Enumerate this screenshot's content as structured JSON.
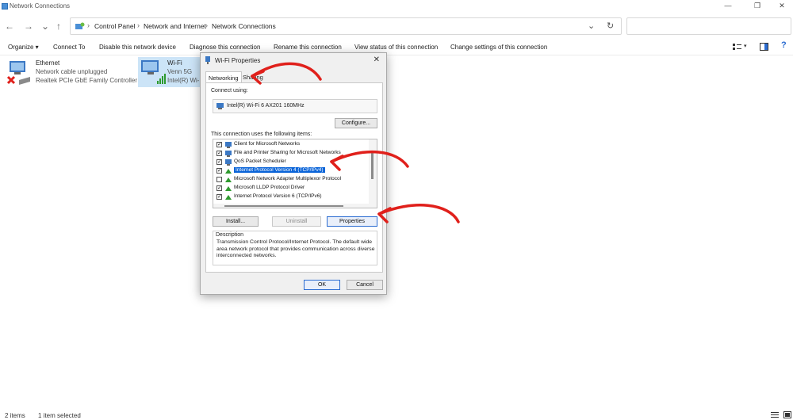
{
  "window": {
    "title": "Network Connections",
    "minimize": "—",
    "maximize": "❐",
    "close": "✕"
  },
  "nav": {
    "back": "←",
    "forward": "→",
    "up": "↑",
    "refresh": "↻",
    "dropdown": "⌄"
  },
  "breadcrumb": [
    "Control Panel",
    "Network and Internet",
    "Network Connections"
  ],
  "search": {
    "placeholder": ""
  },
  "commands": [
    "Organize ▾",
    "Connect To",
    "Disable this network device",
    "Diagnose this connection",
    "Rename this connection",
    "View status of this connection",
    "Change settings of this connection"
  ],
  "connections": [
    {
      "name": "Ethernet",
      "status": "Network cable unplugged",
      "adapter": "Realtek PCIe GbE Family Controller"
    },
    {
      "name": "Wi-Fi",
      "status": "Venn 5G",
      "adapter": "Intel(R) Wi-..."
    }
  ],
  "statusbar": {
    "count": "2 items",
    "selected": "1 item selected"
  },
  "dialog": {
    "title": "Wi-Fi Properties",
    "close": "✕",
    "tabs": [
      "Networking",
      "Sharing"
    ],
    "connect_using_label": "Connect using:",
    "adapter_name": "Intel(R) Wi-Fi 6 AX201 160MHz",
    "configure_button": "Configure...",
    "items_label": "This connection uses the following items:",
    "components": [
      {
        "label": "Client for Microsoft Networks",
        "checked": true,
        "selected": false
      },
      {
        "label": "File and Printer Sharing for Microsoft Networks",
        "checked": true,
        "selected": false
      },
      {
        "label": "QoS Packet Scheduler",
        "checked": true,
        "selected": false
      },
      {
        "label": "Internet Protocol Version 4 (TCP/IPv4)",
        "checked": true,
        "selected": true
      },
      {
        "label": "Microsoft Network Adapter Multiplexor Protocol",
        "checked": false,
        "selected": false
      },
      {
        "label": "Microsoft LLDP Protocol Driver",
        "checked": true,
        "selected": false
      },
      {
        "label": "Internet Protocol Version 6 (TCP/IPv6)",
        "checked": true,
        "selected": false
      }
    ],
    "install_button": "Install...",
    "uninstall_button": "Uninstall",
    "properties_button": "Properties",
    "description_label": "Description",
    "description_text": "Transmission Control Protocol/Internet Protocol. The default wide area network protocol that provides communication across diverse interconnected networks.",
    "ok_button": "OK",
    "cancel_button": "Cancel"
  },
  "colors": {
    "selection": "#0a64d8",
    "annotation_arrow": "#e0201b",
    "selected_item_bg": "#cce4f7"
  }
}
